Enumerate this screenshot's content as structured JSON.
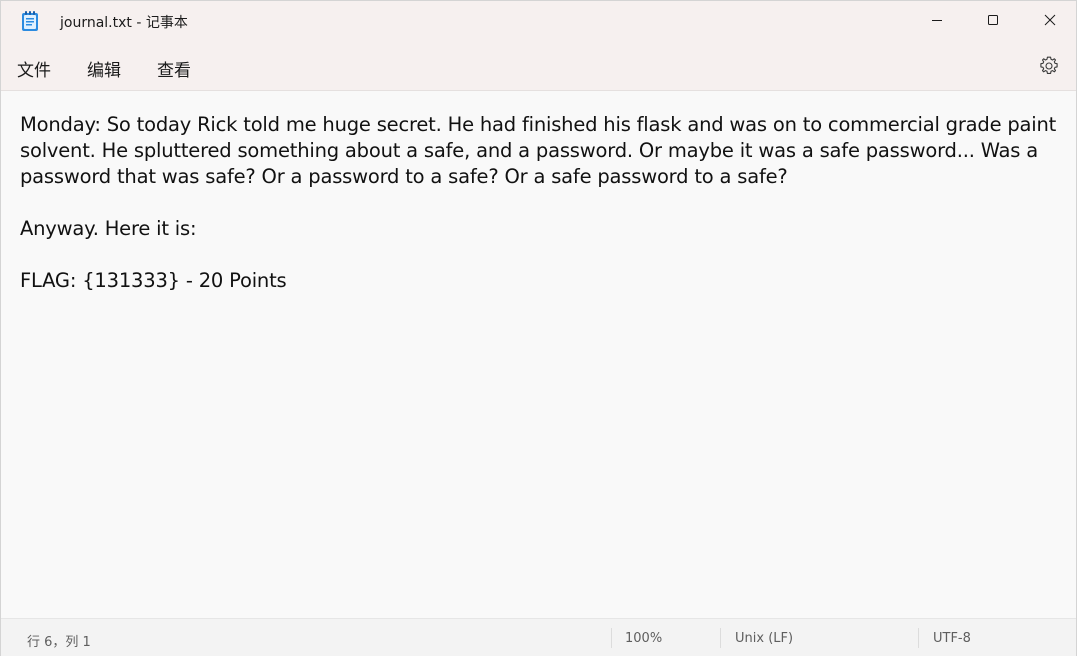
{
  "window": {
    "title": "journal.txt - 记事本"
  },
  "menu": {
    "file": "文件",
    "edit": "编辑",
    "view": "查看"
  },
  "icons": {
    "app": "notepad-icon",
    "minimize": "minimize-icon",
    "maximize": "maximize-icon",
    "close": "close-icon",
    "settings": "gear-icon"
  },
  "editor": {
    "content": "Monday: So today Rick told me huge secret. He had finished his flask and was on to commercial grade paint solvent. He spluttered something about a safe, and a password. Or maybe it was a safe password... Was a password that was safe? Or a password to a safe? Or a safe password to a safe?\n\nAnyway. Here it is:\n\nFLAG: {131333} - 20 Points"
  },
  "status": {
    "position": "行 6，列 1",
    "zoom": "100%",
    "line_ending": "Unix (LF)",
    "encoding": "UTF-8"
  },
  "colors": {
    "titlebar_bg": "#f6f0ef",
    "editor_bg": "#f9f9f9",
    "statusbar_bg": "#f3f3f3",
    "icon_blue": "#1e7ad6"
  }
}
